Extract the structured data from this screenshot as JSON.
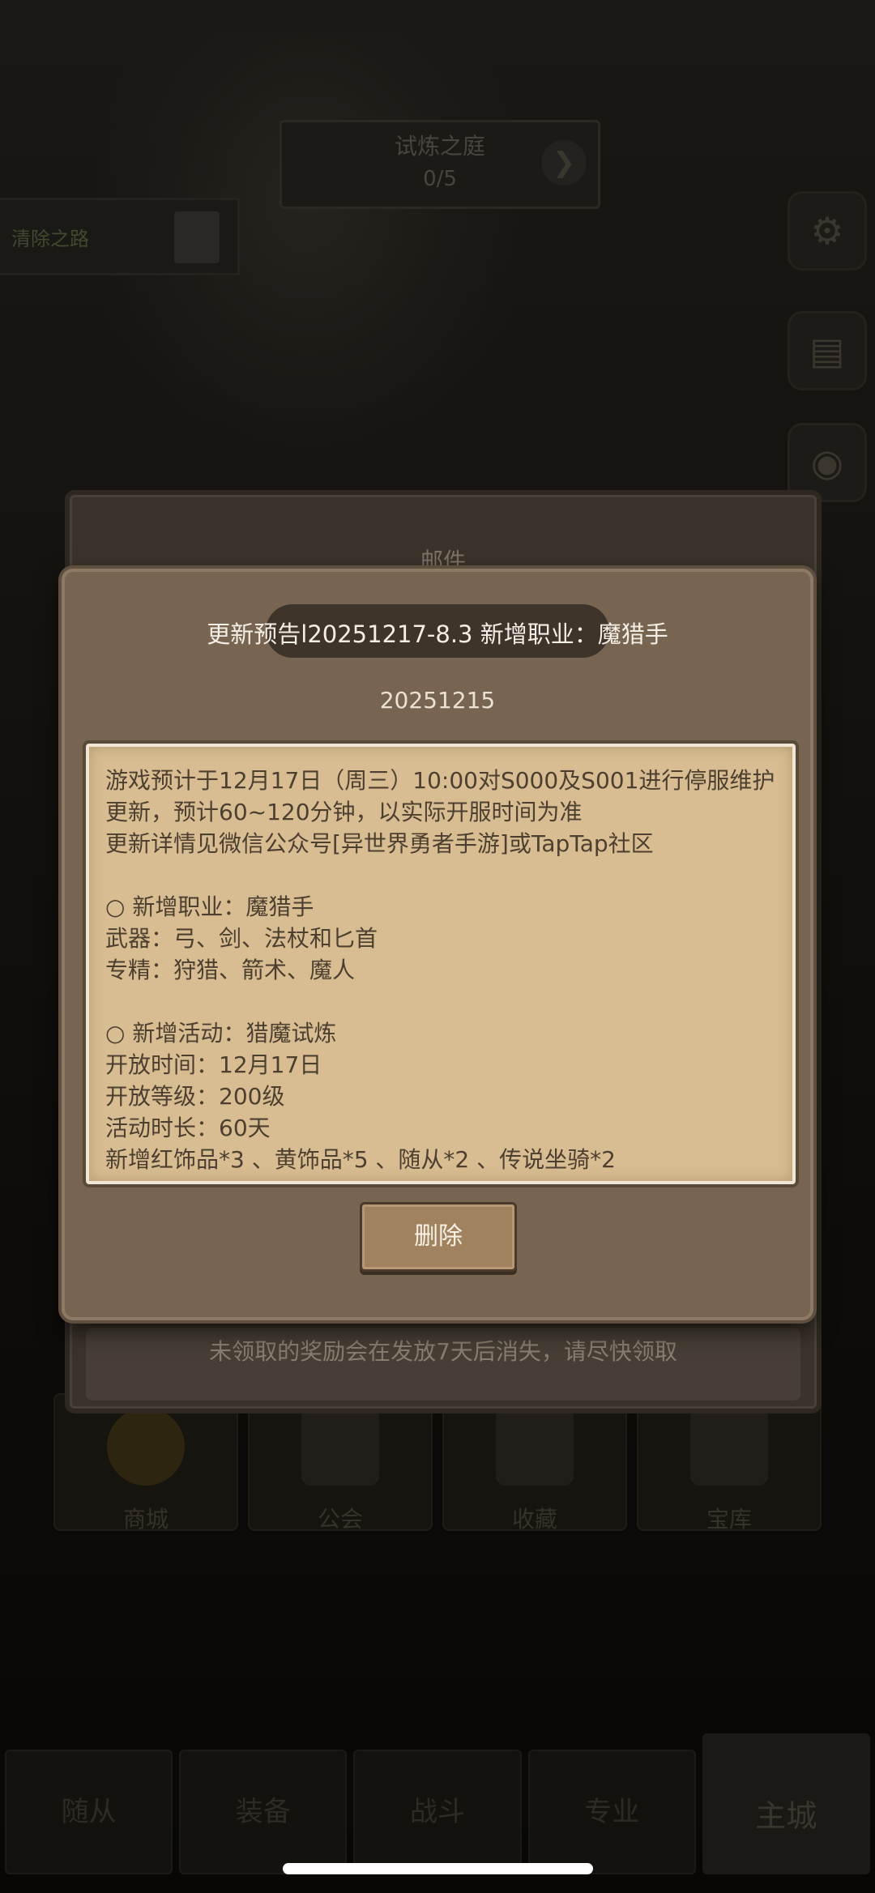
{
  "background": {
    "trial": {
      "title": "试炼之庭",
      "progress": "0/5"
    },
    "task": {
      "label": "清除之路"
    },
    "side_icons": [
      "gear-icon",
      "book-icon",
      "gift-icon"
    ],
    "grid": [
      "商城",
      "公会",
      "收藏",
      "宝库"
    ],
    "nav": [
      "随从",
      "装备",
      "战斗",
      "专业",
      "主城"
    ]
  },
  "mail": {
    "title": "邮件",
    "footer": "未领取的奖励会在发放7天后消失，请尽快领取"
  },
  "popup": {
    "title": "更新预告l20251217-8.3 新增职业：魔猎手",
    "date": "20251215",
    "body": "游戏预计于12月17日（周三）10:00对S000及S001进行停服维护更新，预计60~120分钟，以实际开服时间为准\n更新详情见微信公众号[异世界勇者手游]或TapTap社区\n\n○ 新增职业：魔猎手\n武器：弓、剑、法杖和匕首\n专精：狩猎、箭术、魔人\n\n○ 新增活动：猎魔试炼\n开放时间：12月17日\n开放等级：200级\n活动时长：60天\n新增红饰品*3 、黄饰品*5 、随从*2 、传说坐骑*2",
    "delete_label": "删除"
  }
}
